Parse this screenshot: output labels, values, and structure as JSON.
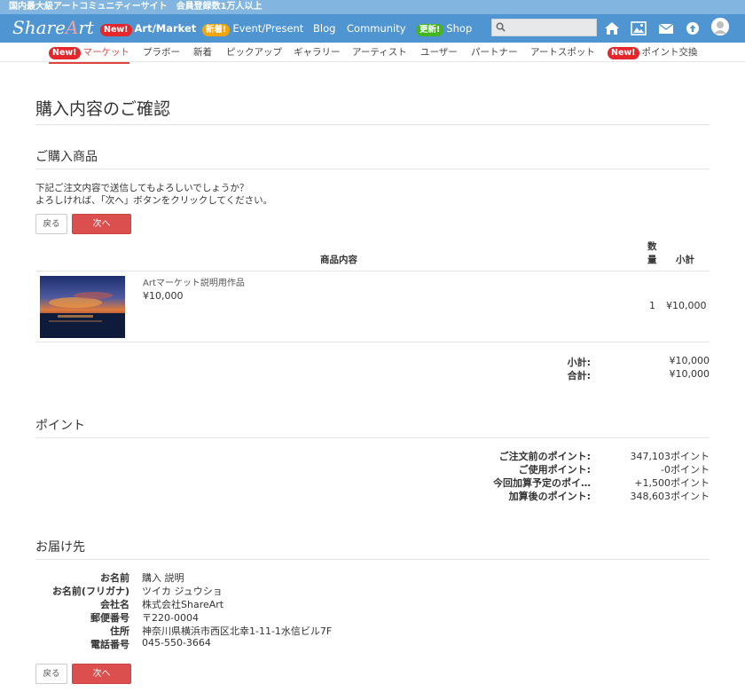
{
  "top_strip": {
    "text": "国内最大級アートコミュニティーサイト　会員登録数1万人以上"
  },
  "navbar": {
    "logo_prefix": "Share",
    "logo_accent": "A",
    "logo_suffix": "rt",
    "items": [
      {
        "badge": "New!",
        "badge_color": "#e5262b",
        "label": "Art/Market"
      },
      {
        "badge": "新着!",
        "badge_color": "#f2a50b",
        "label": "Event/Present"
      },
      {
        "badge": "",
        "label": "Blog"
      },
      {
        "badge": "",
        "label": "Community"
      },
      {
        "badge": "更新!",
        "badge_color": "#43b521",
        "label": "Shop"
      }
    ],
    "search_placeholder": "",
    "icons": [
      "home-icon",
      "gallery-icon",
      "mail-icon",
      "upload-icon",
      "user-avatar"
    ]
  },
  "subnav": {
    "items": [
      {
        "badge": "New!",
        "label": "マーケット",
        "active": true
      },
      {
        "badge": "",
        "label": "プラボー"
      },
      {
        "badge": "",
        "label": "新着"
      },
      {
        "badge": "",
        "label": "ピックアップ"
      },
      {
        "badge": "",
        "label": "ギャラリー"
      },
      {
        "badge": "",
        "label": "アーティスト"
      },
      {
        "badge": "",
        "label": "ユーザー"
      },
      {
        "badge": "",
        "label": "パートナー"
      },
      {
        "badge": "",
        "label": "アートスポット"
      },
      {
        "badge": "New!",
        "label": "ポイント交換"
      }
    ]
  },
  "page": {
    "title": "購入内容のご確認"
  },
  "products": {
    "heading": "ご購入商品",
    "message_line1": "下記ご注文内容で送信してもよろしいでしょうか？",
    "message_line2": "よろしければ、「次へ」ボタンをクリックしてください。",
    "back_label": "戻る",
    "next_label": "次へ",
    "col_content": "商品内容",
    "col_qty_1": "数",
    "col_qty_2": "量",
    "col_subtotal": "小計",
    "items": [
      {
        "title": "Artマーケット説明用作品",
        "price": "¥10,000",
        "qty": "1",
        "subtotal": "¥10,000"
      }
    ],
    "subtotal_label": "小計:",
    "subtotal_value": "¥10,000",
    "total_label": "合計:",
    "total_value": "¥10,000"
  },
  "points": {
    "heading": "ポイント",
    "rows": [
      {
        "label": "ご注文前のポイント:",
        "value": "347,103ポイント"
      },
      {
        "label": "ご使用ポイント:",
        "value": "-0ポイント"
      },
      {
        "label": "今回加算予定のポイ…",
        "value": "+1,500ポイント"
      },
      {
        "label": "加算後のポイント:",
        "value": "348,603ポイント"
      }
    ]
  },
  "delivery": {
    "heading": "お届け先",
    "rows": [
      {
        "label": "お名前",
        "value": "購入 説明"
      },
      {
        "label": "お名前(フリガナ)",
        "value": "ツイカ ジュウショ"
      },
      {
        "label": "会社名",
        "value": "株式会社ShareArt"
      },
      {
        "label": "郵便番号",
        "value": "〒220-0004"
      },
      {
        "label": "住所",
        "value": "神奈川県横浜市西区北幸1-11-1水信ビル7F"
      },
      {
        "label": "電話番号",
        "value": "045-550-3664"
      }
    ],
    "back_label": "戻る",
    "next_label": "次へ"
  }
}
